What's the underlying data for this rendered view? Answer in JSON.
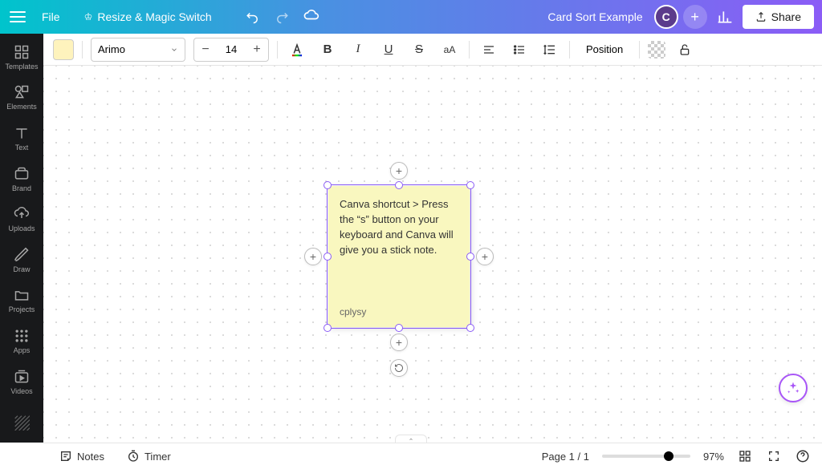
{
  "header": {
    "file_label": "File",
    "resize_label": "Resize & Magic Switch",
    "doc_title": "Card Sort Example",
    "avatar_initial": "C",
    "share_label": "Share"
  },
  "toolbar": {
    "sticky_color": "#fef3bd",
    "font_name": "Arimo",
    "font_size": "14",
    "position_label": "Position"
  },
  "sidebar": {
    "items": [
      {
        "label": "Templates"
      },
      {
        "label": "Elements"
      },
      {
        "label": "Text"
      },
      {
        "label": "Brand"
      },
      {
        "label": "Uploads"
      },
      {
        "label": "Draw"
      },
      {
        "label": "Projects"
      },
      {
        "label": "Apps"
      },
      {
        "label": "Videos"
      }
    ]
  },
  "sticky": {
    "text": "Canva shortcut > Press the “s” button on your keyboard and Canva will give you a stick note.",
    "author": "cplysy"
  },
  "bottombar": {
    "notes_label": "Notes",
    "timer_label": "Timer",
    "page_indicator": "Page 1 / 1",
    "zoom_label": "97%"
  }
}
